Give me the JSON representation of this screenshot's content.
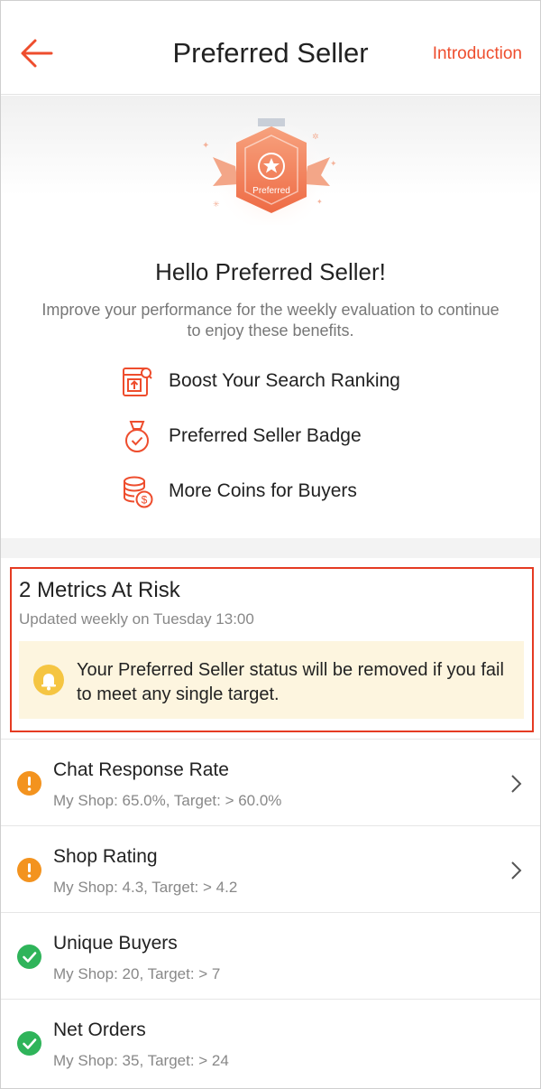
{
  "header": {
    "title": "Preferred Seller",
    "intro_link": "Introduction"
  },
  "hero": {
    "badge_label": "Preferred",
    "greeting": "Hello Preferred Seller!",
    "subtitle": "Improve your performance for the weekly evaluation to continue to enjoy these benefits.",
    "benefits": [
      {
        "label": "Boost Your Search Ranking",
        "icon": "search-ranking-icon"
      },
      {
        "label": "Preferred Seller Badge",
        "icon": "medal-badge-icon"
      },
      {
        "label": "More Coins for Buyers",
        "icon": "coins-icon"
      }
    ]
  },
  "risk": {
    "title": "2 Metrics At Risk",
    "updated": "Updated weekly on Tuesday 13:00",
    "warning": "Your Preferred Seller status will be removed if you fail to meet any single target."
  },
  "metrics": [
    {
      "name": "Chat Response Rate",
      "detail": "My Shop: 65.0%, Target: > 60.0%",
      "status": "warning",
      "has_chevron": true
    },
    {
      "name": "Shop Rating",
      "detail": "My Shop: 4.3, Target: > 4.2",
      "status": "warning",
      "has_chevron": true
    },
    {
      "name": "Unique Buyers",
      "detail": "My Shop: 20, Target: > 7",
      "status": "ok",
      "has_chevron": false
    },
    {
      "name": "Net Orders",
      "detail": "My Shop: 35, Target: > 24",
      "status": "ok",
      "has_chevron": false
    }
  ],
  "colors": {
    "accent": "#ee4d2d",
    "warning": "#f3931f",
    "ok": "#2fb45a",
    "warning_bg": "#fdf5df"
  }
}
